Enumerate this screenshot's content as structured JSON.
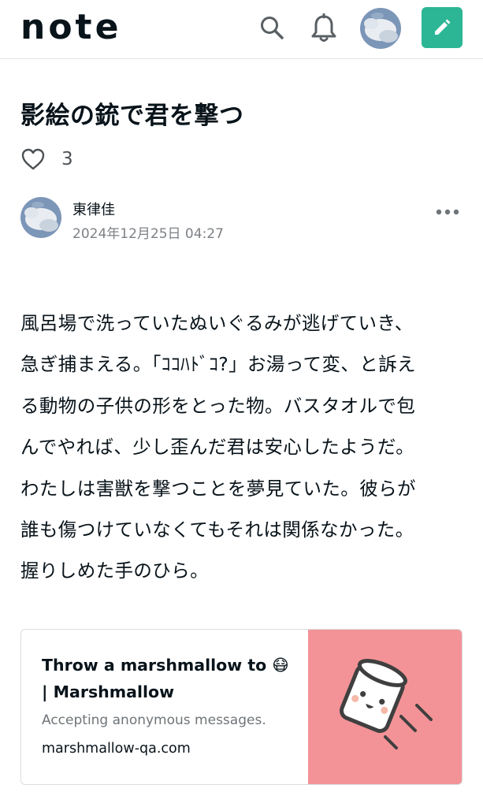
{
  "header": {
    "logo_text": "note",
    "search_icon": "search-icon",
    "notification_icon": "bell-icon",
    "post_button_icon": "pencil-icon",
    "accent_color": "#2cb696"
  },
  "article": {
    "title": "影絵の銃で君を撃つ",
    "like_count": "3",
    "author_name": "東律佳",
    "date": "2024年12月25日 04:27",
    "body_lines": [
      "風呂場で洗っていたぬいぐるみが逃げていき、",
      "急ぎ捕まえる。「ｺｺﾊﾄﾞｺ?」お湯って変、と訴え",
      "る動物の子供の形をとった物。バスタオルで包",
      "んでやれば、少し歪んだ君は安心したようだ。",
      "わたしは害獣を撃つことを夢見ていた。彼らが",
      "誰も傷つけていなくてもそれは関係なかった。",
      "握りしめた手のひら。"
    ]
  },
  "link_card": {
    "title": "Throw a marshmallow to 😷 | Marshmallow",
    "description": "Accepting anonymous messages.",
    "domain": "marshmallow-qa.com",
    "thumb_color": "#f39397"
  }
}
